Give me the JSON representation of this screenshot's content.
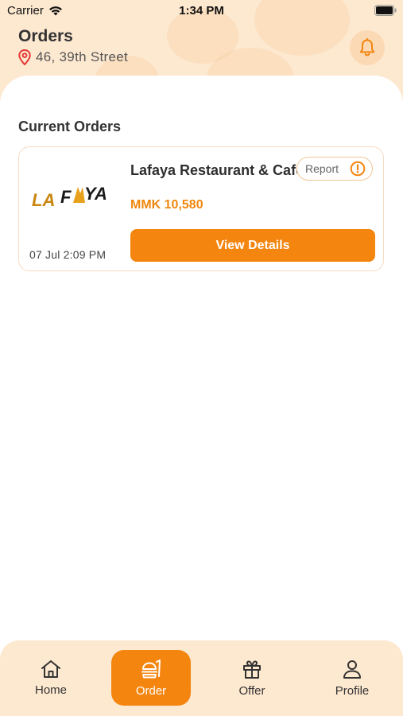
{
  "status_bar": {
    "carrier": "Carrier",
    "time": "1:34 PM"
  },
  "header": {
    "title": "Orders",
    "address": "46, 39th Street",
    "notification_icon": "bell-icon",
    "location_icon": "map-pin-icon"
  },
  "current_orders": {
    "section_title": "Current Orders",
    "orders": [
      {
        "restaurant_name": "Lafaya Restaurant & Cafe",
        "logo_text": "LA FAYA",
        "price": "MMK 10,580",
        "date": "07 Jul 2:09 PM",
        "report_label": "Report",
        "view_details_label": "View Details"
      }
    ]
  },
  "bottom_nav": {
    "active": "Order",
    "items": [
      {
        "label": "Home",
        "icon": "home-icon"
      },
      {
        "label": "Order",
        "icon": "order-icon"
      },
      {
        "label": "Offer",
        "icon": "gift-icon"
      },
      {
        "label": "Profile",
        "icon": "user-icon"
      }
    ]
  },
  "colors": {
    "accent": "#f4850e",
    "header_bg": "#fde8d0",
    "pin_red": "#e53935"
  }
}
